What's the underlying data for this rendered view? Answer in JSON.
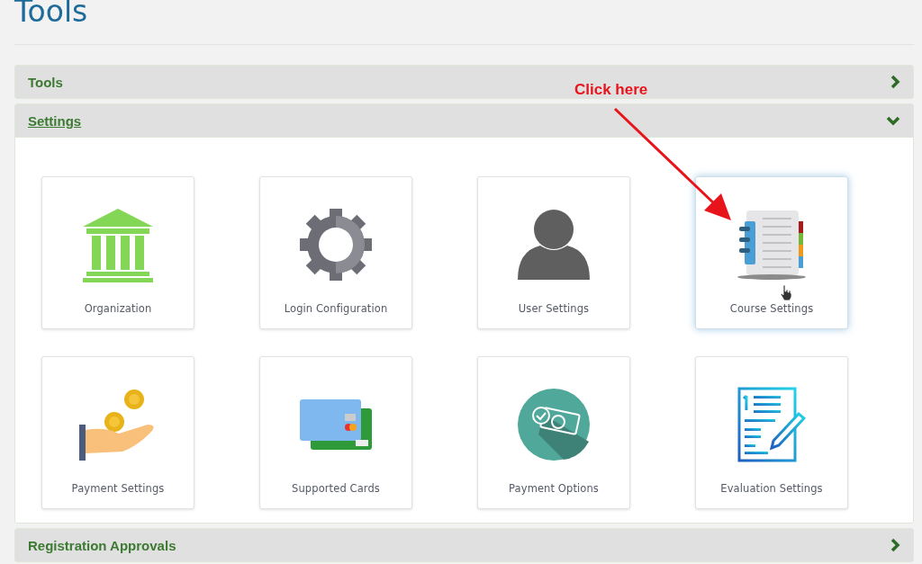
{
  "page_title": "Tools",
  "sections": [
    {
      "title": "Tools",
      "expanded": false
    },
    {
      "title": "Settings",
      "expanded": true,
      "cards": [
        {
          "label": "Organization",
          "selected": false
        },
        {
          "label": "Login Configuration",
          "selected": false
        },
        {
          "label": "User Settings",
          "selected": false
        },
        {
          "label": "Course Settings",
          "selected": true
        },
        {
          "label": "Payment Settings",
          "selected": false
        },
        {
          "label": "Supported Cards",
          "selected": false
        },
        {
          "label": "Payment Options",
          "selected": false
        },
        {
          "label": "Evaluation Settings",
          "selected": false
        }
      ]
    },
    {
      "title": "Registration Approvals",
      "expanded": false
    }
  ],
  "annotation": {
    "text": "Click here"
  }
}
